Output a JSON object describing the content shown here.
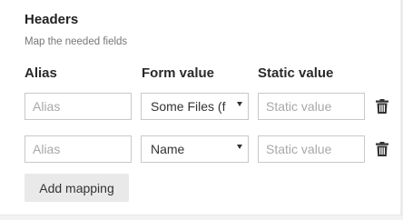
{
  "section": {
    "title": "Headers",
    "subtitle": "Map the needed fields"
  },
  "columns": {
    "alias": "Alias",
    "form_value": "Form value",
    "static_value": "Static value"
  },
  "rows": [
    {
      "alias_placeholder": "Alias",
      "alias_value": "",
      "form_value_selected": "Some Files (f",
      "static_placeholder": "Static value",
      "static_value": "",
      "delete_icon": "trash-icon"
    },
    {
      "alias_placeholder": "Alias",
      "alias_value": "",
      "form_value_selected": "Name",
      "static_placeholder": "Static value",
      "static_value": "",
      "delete_icon": "trash-icon"
    }
  ],
  "actions": {
    "add_mapping_label": "Add mapping"
  },
  "colors": {
    "border": "#c8c8c8",
    "button_bg": "#e9e9e9",
    "placeholder": "#a8a8a8",
    "text": "#333333"
  }
}
